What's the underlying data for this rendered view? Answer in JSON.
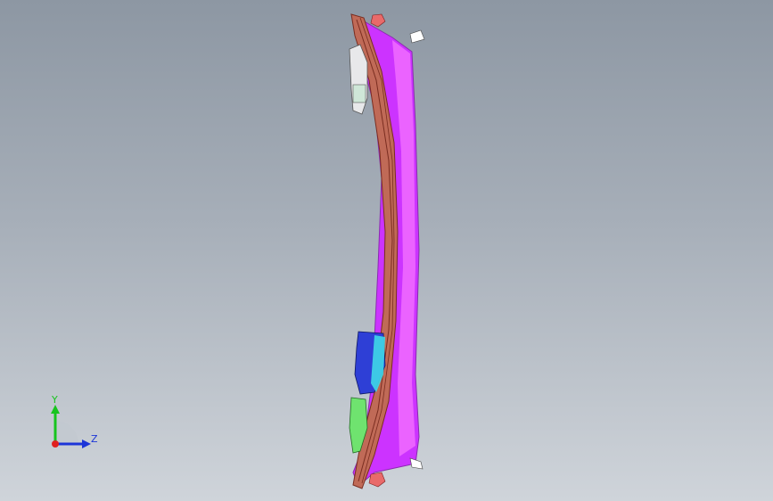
{
  "viewport": {
    "background_top": "#8d97a3",
    "background_bottom": "#cfd4da"
  },
  "model": {
    "colors": {
      "body": "#cc33ff",
      "body_light": "#f06cff",
      "edge": "#8a2bb0",
      "beam": "#c06a57",
      "beam_line": "#7a2d20",
      "light_grey": "#e8e8ea",
      "bracket_blue": "#2e3fd6",
      "bracket_cyan": "#3fd8e8",
      "bracket_green": "#6fe36f",
      "cap_red": "#e96a6a"
    }
  },
  "triad": {
    "y_label": "Y",
    "z_label": "Z",
    "y_color": "#17c41e",
    "z_color": "#1c35d8",
    "x_color": "#e02020"
  }
}
